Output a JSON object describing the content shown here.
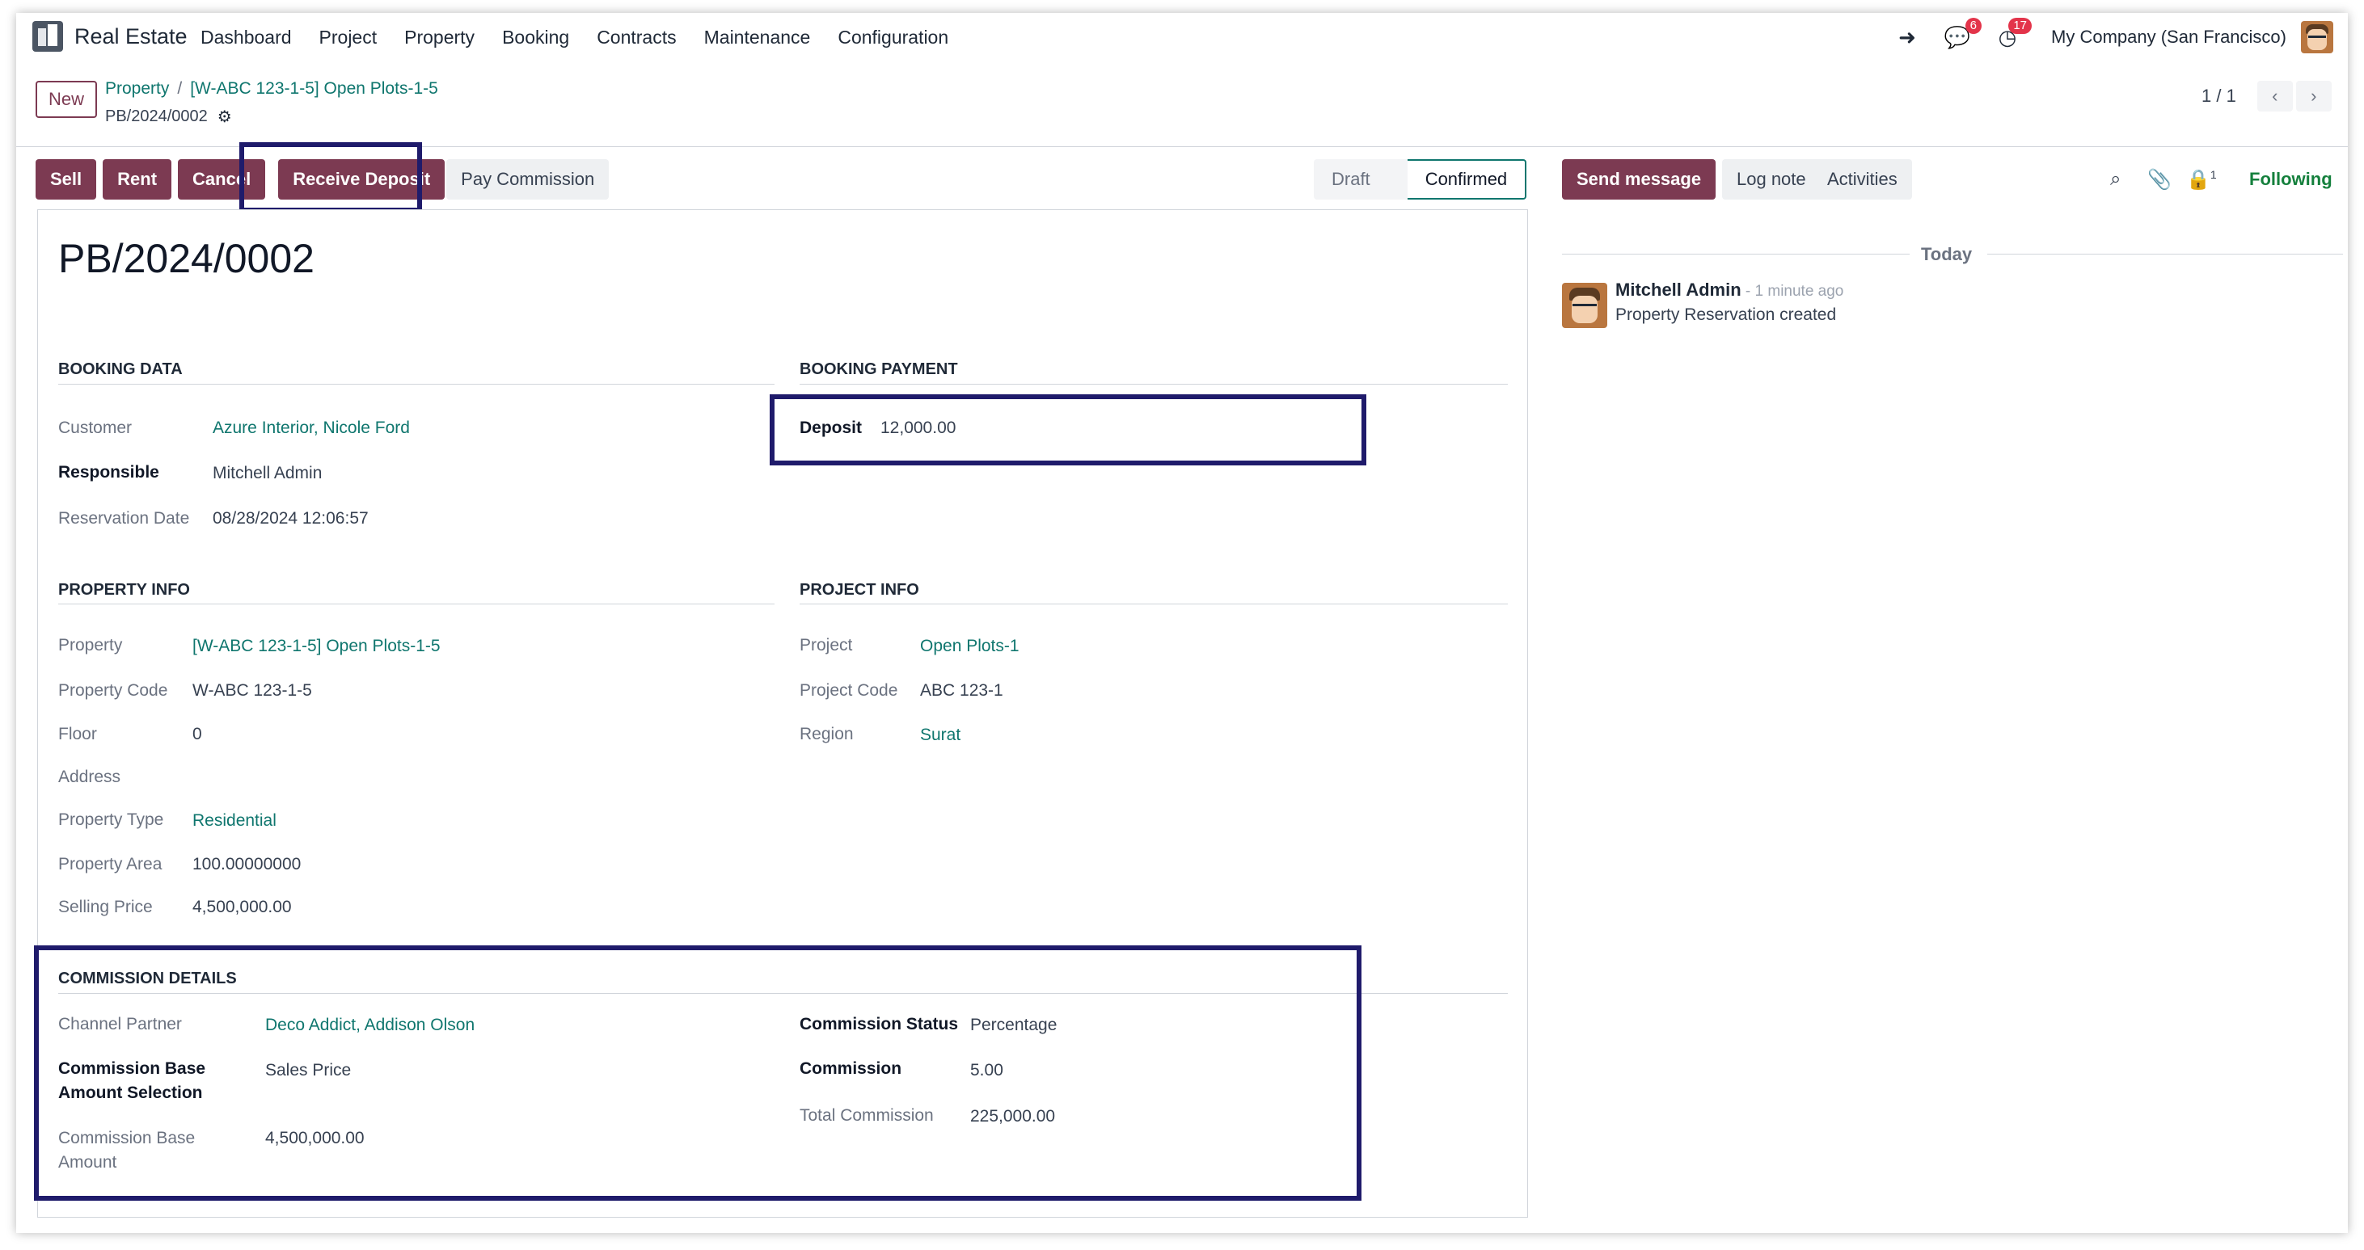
{
  "navbar": {
    "app_name": "Real Estate",
    "menu": [
      "Dashboard",
      "Project",
      "Property",
      "Booking",
      "Contracts",
      "Maintenance",
      "Configuration"
    ],
    "messages_count": "6",
    "activities_count": "17",
    "company": "My Company (San Francisco)"
  },
  "control_panel": {
    "new_label": "New",
    "breadcrumb": [
      "Property",
      "[W-ABC 123-1-5] Open Plots-1-5"
    ],
    "record_name": "PB/2024/0002",
    "pager": "1 / 1"
  },
  "actions": {
    "sell": "Sell",
    "rent": "Rent",
    "cancel": "Cancel",
    "receive_deposit": "Receive Deposit",
    "pay_commission": "Pay Commission"
  },
  "statusbar": {
    "draft": "Draft",
    "confirmed": "Confirmed"
  },
  "form": {
    "title": "PB/2024/0002",
    "booking_data": {
      "heading": "BOOKING DATA",
      "customer_label": "Customer",
      "customer": "Azure Interior, Nicole Ford",
      "responsible_label": "Responsible",
      "responsible": "Mitchell Admin",
      "reservation_date_label": "Reservation Date",
      "reservation_date": "08/28/2024 12:06:57"
    },
    "booking_payment": {
      "heading": "BOOKING PAYMENT",
      "deposit_label": "Deposit",
      "deposit": "12,000.00"
    },
    "property_info": {
      "heading": "PROPERTY INFO",
      "property_label": "Property",
      "property": "[W-ABC 123-1-5] Open Plots-1-5",
      "property_code_label": "Property Code",
      "property_code": "W-ABC 123-1-5",
      "floor_label": "Floor",
      "floor": "0",
      "address_label": "Address",
      "property_type_label": "Property Type",
      "property_type": "Residential",
      "property_area_label": "Property Area",
      "property_area": "100.00000000",
      "selling_price_label": "Selling Price",
      "selling_price": "4,500,000.00"
    },
    "project_info": {
      "heading": "PROJECT INFO",
      "project_label": "Project",
      "project": "Open Plots-1",
      "project_code_label": "Project Code",
      "project_code": "ABC 123-1",
      "region_label": "Region",
      "region": "Surat"
    },
    "commission": {
      "heading": "COMMISSION DETAILS",
      "channel_partner_label": "Channel Partner",
      "channel_partner": "Deco Addict, Addison Olson",
      "base_selection_label_1": "Commission Base",
      "base_selection_label_2": "Amount Selection",
      "base_selection": "Sales Price",
      "base_amount_label_1": "Commission Base",
      "base_amount_label_2": "Amount",
      "base_amount": "4,500,000.00",
      "status_label": "Commission Status",
      "status": "Percentage",
      "commission_label": "Commission",
      "commission": "5.00",
      "total_label": "Total Commission",
      "total": "225,000.00"
    }
  },
  "chatter": {
    "send_message": "Send message",
    "log_note": "Log note",
    "activities": "Activities",
    "followers_count": "1",
    "following": "Following",
    "date_separator": "Today",
    "message": {
      "author": "Mitchell Admin",
      "time": " - 1 minute ago",
      "body": "Property Reservation created"
    }
  },
  "colors": {
    "brand": "#7c3a52",
    "link": "#0f766e",
    "highlight_box": "#1f1b6b",
    "following": "#15803d"
  }
}
